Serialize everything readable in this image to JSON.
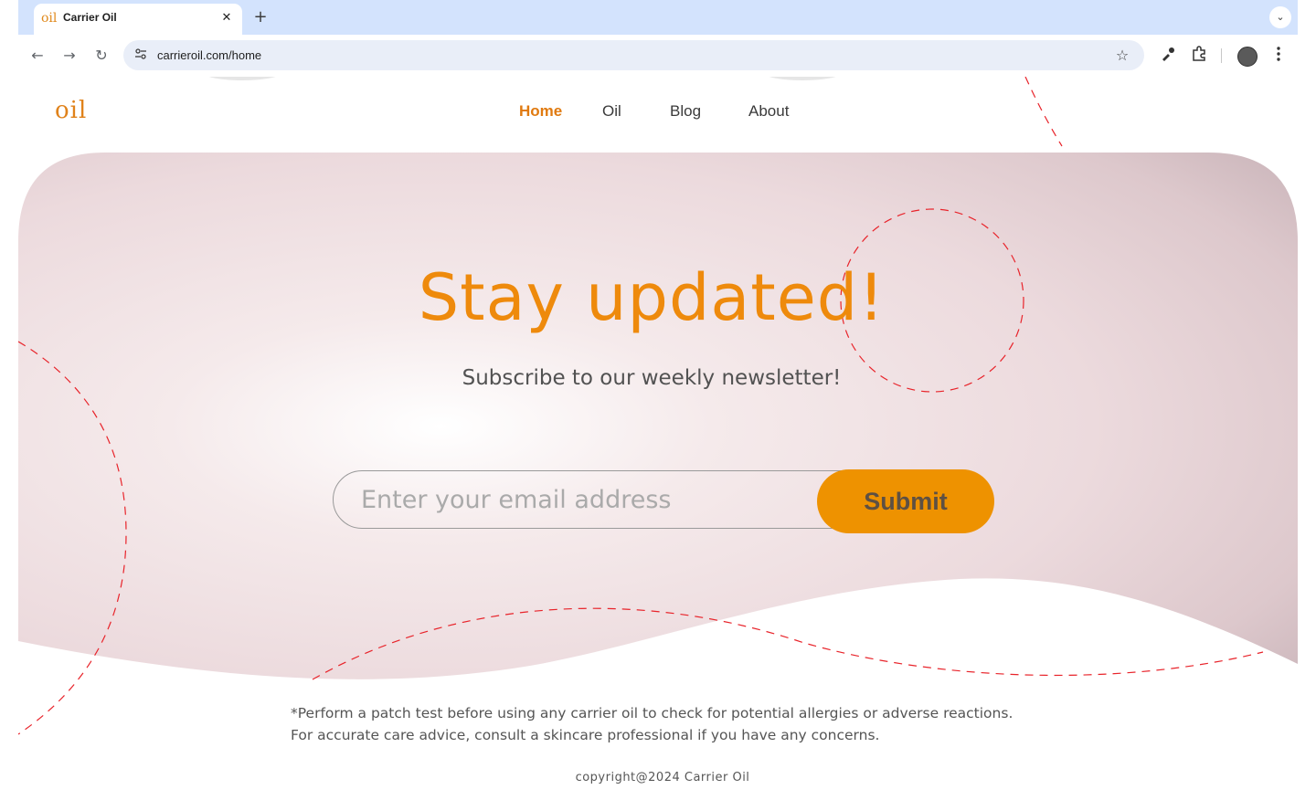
{
  "browser": {
    "tab_favicon_text": "oil",
    "tab_title": "Carrier Oil",
    "tab_close": "✕",
    "new_tab": "+",
    "tab_search": "⌄",
    "back": "←",
    "forward": "→",
    "reload": "↻",
    "url": "carrieroil.com/home",
    "star": "☆"
  },
  "site": {
    "logo": "oil",
    "nav": [
      "Home",
      "Oil",
      "Blog",
      "About"
    ],
    "active_nav": "Home"
  },
  "hero": {
    "title": "Stay updated!",
    "subtitle": "Subscribe to our weekly newsletter!",
    "email_placeholder": "Enter your email address",
    "submit_label": "Submit"
  },
  "footer": {
    "disclaimer_line1": "*Perform a patch test before using any carrier oil to check for potential allergies or adverse reactions.",
    "disclaimer_line2": "For accurate care advice, consult a skincare professional if you have any concerns.",
    "copyright": "copyright@2024 Carrier Oil"
  },
  "colors": {
    "accent": "#ee8a0c",
    "button": "#ee9200",
    "dash": "#e8232a",
    "hero_bg": "#e8d2d6"
  }
}
